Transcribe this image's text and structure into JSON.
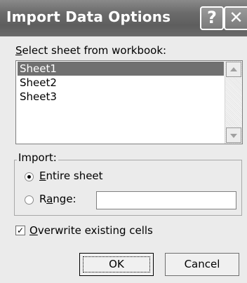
{
  "dialog": {
    "title": "Import Data Options",
    "help_glyph": "?",
    "close_glyph": "✕"
  },
  "sheet_select": {
    "label_access_key": "S",
    "label_rest": "elect sheet from workbook:",
    "items": [
      {
        "label": "Sheet1",
        "selected": true
      },
      {
        "label": "Sheet2",
        "selected": false
      },
      {
        "label": "Sheet3",
        "selected": false
      }
    ]
  },
  "import_group": {
    "legend": "Import:",
    "entire_sheet": {
      "access_key": "E",
      "rest": "ntire sheet",
      "checked": true
    },
    "range": {
      "prefix": "R",
      "access_key": "a",
      "rest": "nge:",
      "checked": false,
      "value": ""
    }
  },
  "overwrite": {
    "access_key": "O",
    "rest": "verwrite existing cells",
    "checked": true,
    "check_glyph": "✓"
  },
  "buttons": {
    "ok": "OK",
    "cancel": "Cancel"
  },
  "icons": {
    "scroll_up": "arrow-up-icon",
    "scroll_down": "arrow-down-icon"
  }
}
